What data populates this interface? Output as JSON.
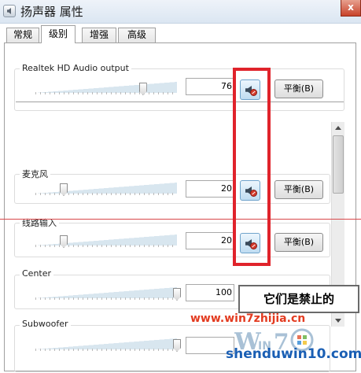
{
  "window": {
    "title": "扬声器 属性",
    "close_label": "x"
  },
  "tabs": [
    {
      "label": "常规"
    },
    {
      "label": "级别"
    },
    {
      "label": "增强"
    },
    {
      "label": "高级"
    }
  ],
  "channels": [
    {
      "label": "Realtek HD Audio output",
      "value": "76",
      "level": 0.76,
      "balance_label": "平衡(B)"
    },
    {
      "label": "麦克风",
      "value": "20",
      "level": 0.2,
      "balance_label": "平衡(B)"
    },
    {
      "label": "线路输入",
      "value": "20",
      "level": 0.2,
      "balance_label": "平衡(B)"
    },
    {
      "label": "Center",
      "value": "100",
      "level": 1.0
    },
    {
      "label": "Subwoofer",
      "level": 1.0
    }
  ],
  "annotation": {
    "callout": "它们是禁止的"
  },
  "watermark": {
    "url": "www.win7zhijia.cn",
    "site": "shenduwin10.com"
  }
}
